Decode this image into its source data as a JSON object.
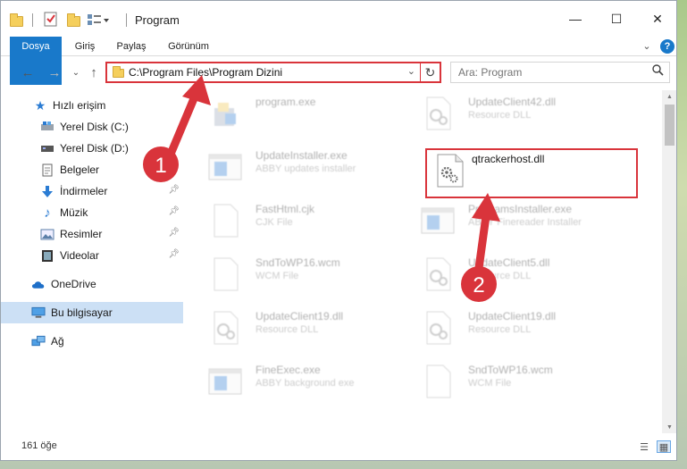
{
  "window": {
    "title": "Program",
    "minimize_glyph": "—",
    "maximize_glyph": "☐",
    "close_glyph": "✕"
  },
  "ribbon": {
    "tabs": [
      "Dosya",
      "Giriş",
      "Paylaş",
      "Görünüm"
    ],
    "expand_glyph": "⌄",
    "help_glyph": "?"
  },
  "address": {
    "path": "C:\\Program Files\\Program Dizini",
    "back_glyph": "←",
    "forward_glyph": "→",
    "recent_glyph": "⌄",
    "up_glyph": "↑",
    "dropdown_glyph": "⌄",
    "refresh_glyph": "↻"
  },
  "search": {
    "placeholder": "Ara: Program",
    "icon": "search-icon"
  },
  "nav": {
    "items": [
      {
        "label": "Hızlı erişim",
        "icon": "star-icon",
        "pinned": false
      },
      {
        "label": "Yerel Disk (C:)",
        "icon": "drive-c-icon",
        "pinned": false
      },
      {
        "label": "Yerel Disk (D:)",
        "icon": "drive-d-icon",
        "pinned": true
      },
      {
        "label": "Belgeler",
        "icon": "documents-icon",
        "pinned": true
      },
      {
        "label": "İndirmeler",
        "icon": "download-icon",
        "pinned": true
      },
      {
        "label": "Müzik",
        "icon": "music-icon",
        "pinned": true
      },
      {
        "label": "Resimler",
        "icon": "pictures-icon",
        "pinned": true
      },
      {
        "label": "Videolar",
        "icon": "videos-icon",
        "pinned": true
      },
      {
        "label": "OneDrive",
        "icon": "onedrive-icon",
        "pinned": false
      },
      {
        "label": "Bu bilgisayar",
        "icon": "computer-icon",
        "pinned": false,
        "selected": true
      },
      {
        "label": "Ağ",
        "icon": "network-icon",
        "pinned": false
      }
    ]
  },
  "files": [
    {
      "name": "program.exe",
      "type": "",
      "icon": "installer-icon",
      "faded": true
    },
    {
      "name": "UpdateClient42.dll",
      "type": "Resource DLL",
      "icon": "dll-icon",
      "faded": true
    },
    {
      "name": "UpdateInstaller.exe",
      "type": "ABBY updates installer",
      "icon": "exe-window-icon",
      "faded": true
    },
    {
      "name": "qtrackerhost.dll",
      "type": "",
      "icon": "dll-gears-icon",
      "faded": false,
      "highlighted": true
    },
    {
      "name": "FastHtml.cjk",
      "type": "CJK File",
      "icon": "blank-file-icon",
      "faded": true
    },
    {
      "name": "ProgramsInstaller.exe",
      "type": "ABBY Finereader Installer",
      "icon": "exe-window-icon",
      "faded": true
    },
    {
      "name": "SndToWP16.wcm",
      "type": "WCM File",
      "icon": "blank-file-icon",
      "faded": true
    },
    {
      "name": "UpdateClient5.dll",
      "type": "Resource DLL",
      "icon": "dll-icon",
      "faded": true
    },
    {
      "name": "UpdateClient19.dll",
      "type": "Resource DLL",
      "icon": "dll-icon",
      "faded": true
    },
    {
      "name": "UpdateClient19.dll",
      "type": "Resource DLL",
      "icon": "dll-icon",
      "faded": true
    },
    {
      "name": "FineExec.exe",
      "type": "ABBY background exe",
      "icon": "exe-window-icon",
      "faded": true
    },
    {
      "name": "SndToWP16.wcm",
      "type": "WCM File",
      "icon": "blank-file-icon",
      "faded": true
    }
  ],
  "annotations": {
    "step1": "1",
    "step2": "2",
    "color": "#d9343b"
  },
  "status": {
    "count": "161 öğe"
  },
  "colors": {
    "accent": "#1979ca",
    "selected": "#cce0f5",
    "annotation": "#d9343b"
  }
}
